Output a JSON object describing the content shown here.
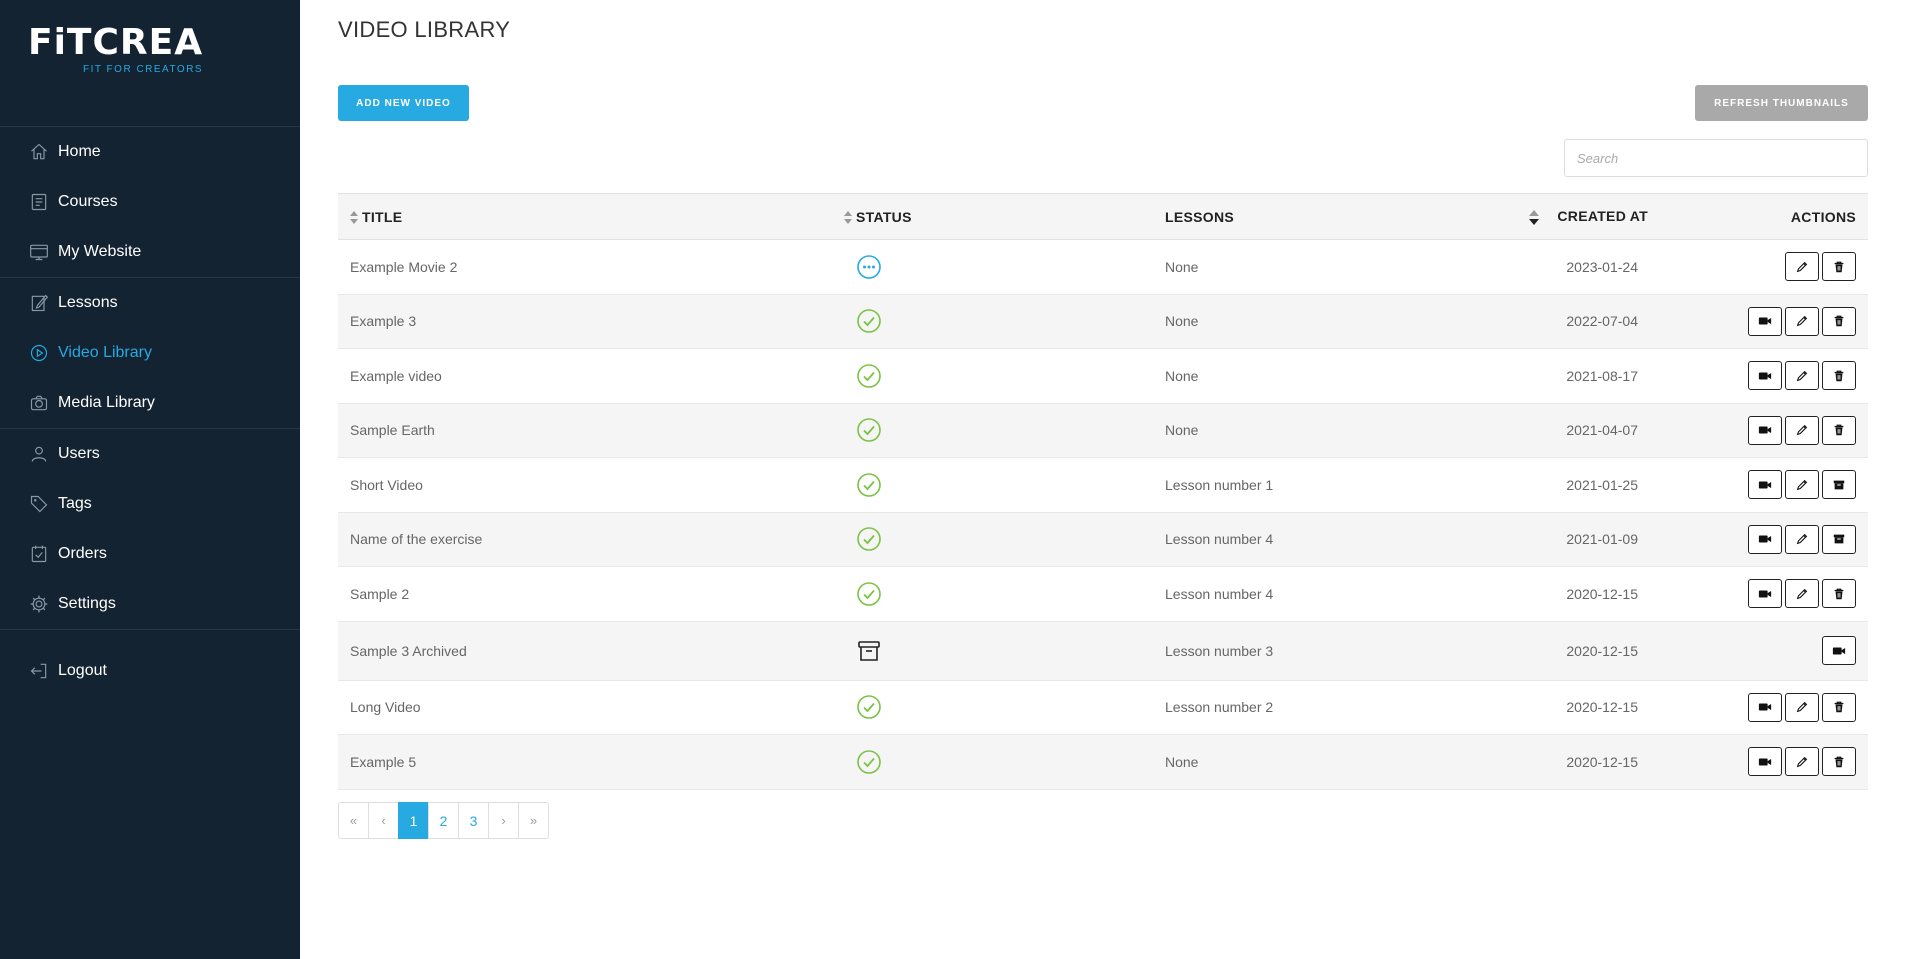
{
  "brand": {
    "name": "FiTCREA",
    "tagline": "FIT FOR CREATORS"
  },
  "sidebar": {
    "groups": [
      [
        {
          "label": "Home",
          "icon": "home-icon"
        },
        {
          "label": "Courses",
          "icon": "courses-icon"
        },
        {
          "label": "My Website",
          "icon": "website-icon"
        }
      ],
      [
        {
          "label": "Lessons",
          "icon": "lessons-icon"
        },
        {
          "label": "Video Library",
          "icon": "play-icon",
          "active": true
        },
        {
          "label": "Media Library",
          "icon": "camera-icon"
        }
      ],
      [
        {
          "label": "Users",
          "icon": "user-icon"
        },
        {
          "label": "Tags",
          "icon": "tag-icon"
        },
        {
          "label": "Orders",
          "icon": "orders-icon"
        },
        {
          "label": "Settings",
          "icon": "gear-icon"
        }
      ],
      [
        {
          "label": "Logout",
          "icon": "logout-icon"
        }
      ]
    ]
  },
  "page": {
    "title": "VIDEO LIBRARY",
    "add_button": "ADD NEW VIDEO",
    "refresh_button": "REFRESH THUMBNAILS",
    "search_placeholder": "Search"
  },
  "table": {
    "headers": {
      "title": "TITLE",
      "status": "STATUS",
      "lessons": "LESSONS",
      "created": "CREATED AT",
      "actions": "ACTIONS"
    },
    "rows": [
      {
        "title": "Example Movie 2",
        "status": "processing",
        "lessons": "None",
        "created": "2023-01-24",
        "actions": [
          "edit",
          "delete"
        ]
      },
      {
        "title": "Example 3",
        "status": "ready",
        "lessons": "None",
        "created": "2022-07-04",
        "actions": [
          "video",
          "edit",
          "delete"
        ]
      },
      {
        "title": "Example video",
        "status": "ready",
        "lessons": "None",
        "created": "2021-08-17",
        "actions": [
          "video",
          "edit",
          "delete"
        ]
      },
      {
        "title": "Sample Earth",
        "status": "ready",
        "lessons": "None",
        "created": "2021-04-07",
        "actions": [
          "video",
          "edit",
          "delete"
        ]
      },
      {
        "title": "Short Video",
        "status": "ready",
        "lessons": "Lesson number 1",
        "created": "2021-01-25",
        "actions": [
          "video",
          "edit",
          "archive"
        ]
      },
      {
        "title": "Name of the exercise",
        "status": "ready",
        "lessons": "Lesson number 4",
        "created": "2021-01-09",
        "actions": [
          "video",
          "edit",
          "archive"
        ]
      },
      {
        "title": "Sample 2",
        "status": "ready",
        "lessons": "Lesson number 4",
        "created": "2020-12-15",
        "actions": [
          "video",
          "edit",
          "delete"
        ]
      },
      {
        "title": "Sample 3 Archived",
        "status": "archived",
        "lessons": "Lesson number 3",
        "created": "2020-12-15",
        "actions": [
          "video"
        ]
      },
      {
        "title": "Long Video",
        "status": "ready",
        "lessons": "Lesson number 2",
        "created": "2020-12-15",
        "actions": [
          "video",
          "edit",
          "delete"
        ]
      },
      {
        "title": "Example 5",
        "status": "ready",
        "lessons": "None",
        "created": "2020-12-15",
        "actions": [
          "video",
          "edit",
          "delete"
        ]
      }
    ]
  },
  "pagination": {
    "first": "«",
    "prev": "‹",
    "next": "›",
    "last": "»",
    "pages": [
      "1",
      "2",
      "3"
    ],
    "current": "1"
  },
  "colors": {
    "sidebar_bg": "#132331",
    "accent": "#27a9e1",
    "success": "#7cc242",
    "refresh_btn": "#a9a9a9"
  }
}
